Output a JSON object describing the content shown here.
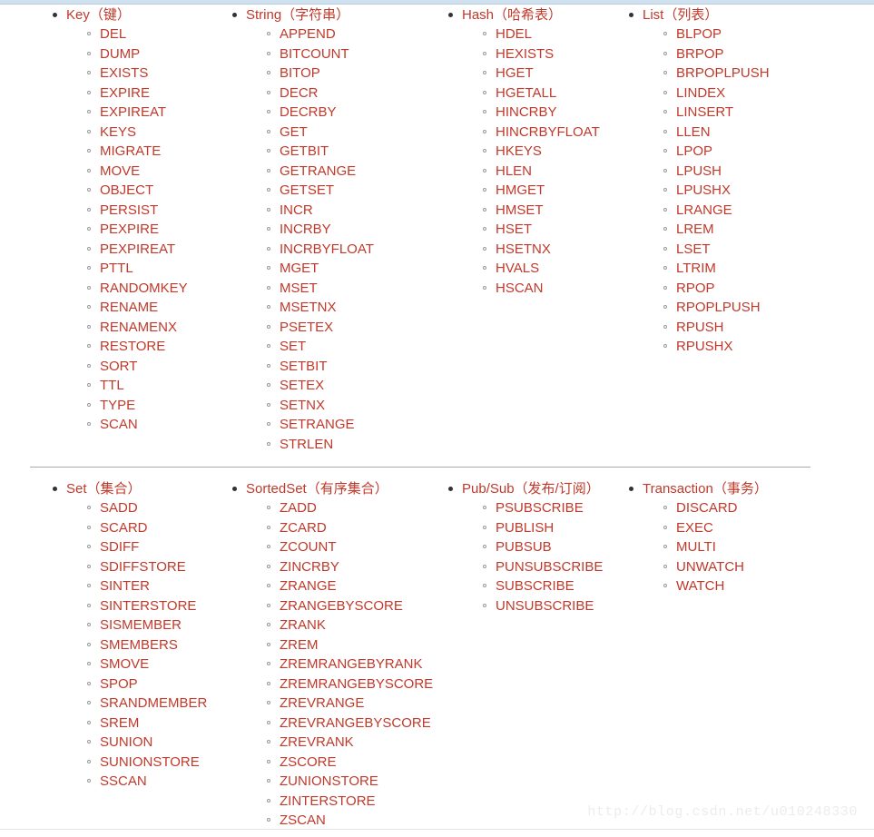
{
  "page": {
    "title": "Redis Commands Reference",
    "accent_color": "#c0392b",
    "bullet_color": "#333333",
    "ring_color": "#9a9a9a",
    "top_band_color": "#cfe0ef",
    "divider_color": "#a9a9a9",
    "background_color": "#ffffff",
    "watermark": "http://blog.csdn.net/u010248330"
  },
  "sections": [
    {
      "name": "section-top",
      "groups": [
        {
          "title": "Key（键）",
          "commands": [
            "DEL",
            "DUMP",
            "EXISTS",
            "EXPIRE",
            "EXPIREAT",
            "KEYS",
            "MIGRATE",
            "MOVE",
            "OBJECT",
            "PERSIST",
            "PEXPIRE",
            "PEXPIREAT",
            "PTTL",
            "RANDOMKEY",
            "RENAME",
            "RENAMENX",
            "RESTORE",
            "SORT",
            "TTL",
            "TYPE",
            "SCAN"
          ]
        },
        {
          "title": "String（字符串）",
          "commands": [
            "APPEND",
            "BITCOUNT",
            "BITOP",
            "DECR",
            "DECRBY",
            "GET",
            "GETBIT",
            "GETRANGE",
            "GETSET",
            "INCR",
            "INCRBY",
            "INCRBYFLOAT",
            "MGET",
            "MSET",
            "MSETNX",
            "PSETEX",
            "SET",
            "SETBIT",
            "SETEX",
            "SETNX",
            "SETRANGE",
            "STRLEN"
          ]
        },
        {
          "title": "Hash（哈希表）",
          "commands": [
            "HDEL",
            "HEXISTS",
            "HGET",
            "HGETALL",
            "HINCRBY",
            "HINCRBYFLOAT",
            "HKEYS",
            "HLEN",
            "HMGET",
            "HMSET",
            "HSET",
            "HSETNX",
            "HVALS",
            "HSCAN"
          ]
        },
        {
          "title": "List（列表）",
          "commands": [
            "BLPOP",
            "BRPOP",
            "BRPOPLPUSH",
            "LINDEX",
            "LINSERT",
            "LLEN",
            "LPOP",
            "LPUSH",
            "LPUSHX",
            "LRANGE",
            "LREM",
            "LSET",
            "LTRIM",
            "RPOP",
            "RPOPLPUSH",
            "RPUSH",
            "RPUSHX"
          ]
        }
      ]
    },
    {
      "name": "section-bottom",
      "groups": [
        {
          "title": "Set（集合）",
          "commands": [
            "SADD",
            "SCARD",
            "SDIFF",
            "SDIFFSTORE",
            "SINTER",
            "SINTERSTORE",
            "SISMEMBER",
            "SMEMBERS",
            "SMOVE",
            "SPOP",
            "SRANDMEMBER",
            "SREM",
            "SUNION",
            "SUNIONSTORE",
            "SSCAN"
          ]
        },
        {
          "title": "SortedSet（有序集合）",
          "commands": [
            "ZADD",
            "ZCARD",
            "ZCOUNT",
            "ZINCRBY",
            "ZRANGE",
            "ZRANGEBYSCORE",
            "ZRANK",
            "ZREM",
            "ZREMRANGEBYRANK",
            "ZREMRANGEBYSCORE",
            "ZREVRANGE",
            "ZREVRANGEBYSCORE",
            "ZREVRANK",
            "ZSCORE",
            "ZUNIONSTORE",
            "ZINTERSTORE",
            "ZSCAN"
          ]
        },
        {
          "title": "Pub/Sub（发布/订阅）",
          "commands": [
            "PSUBSCRIBE",
            "PUBLISH",
            "PUBSUB",
            "PUNSUBSCRIBE",
            "SUBSCRIBE",
            "UNSUBSCRIBE"
          ]
        },
        {
          "title": "Transaction（事务）",
          "commands": [
            "DISCARD",
            "EXEC",
            "MULTI",
            "UNWATCH",
            "WATCH"
          ]
        }
      ]
    }
  ]
}
